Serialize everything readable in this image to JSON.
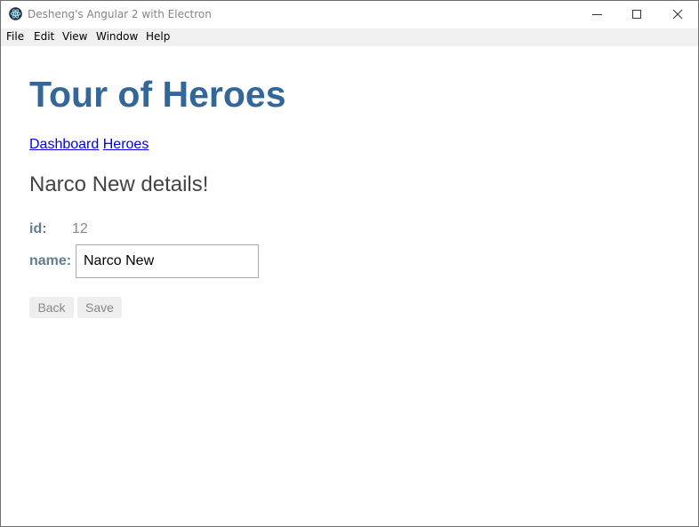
{
  "window": {
    "title": "Desheng's Angular 2 with Electron",
    "icon": "electron-atom-icon",
    "controls": [
      "minimize-icon",
      "maximize-icon",
      "close-icon"
    ]
  },
  "menubar": {
    "items": [
      "File",
      "Edit",
      "View",
      "Window",
      "Help"
    ]
  },
  "app": {
    "title": "Tour of Heroes",
    "nav": {
      "dashboard": "Dashboard",
      "heroes": "Heroes"
    }
  },
  "hero_detail": {
    "heading": "Narco New details!",
    "id_label": "id:",
    "id_value": "12",
    "name_label": "name:",
    "name_value": "Narco New"
  },
  "actions": {
    "back": "Back",
    "save": "Save"
  },
  "colors": {
    "title": "#336699",
    "label": "#607d8b",
    "link": "#0000ee"
  }
}
